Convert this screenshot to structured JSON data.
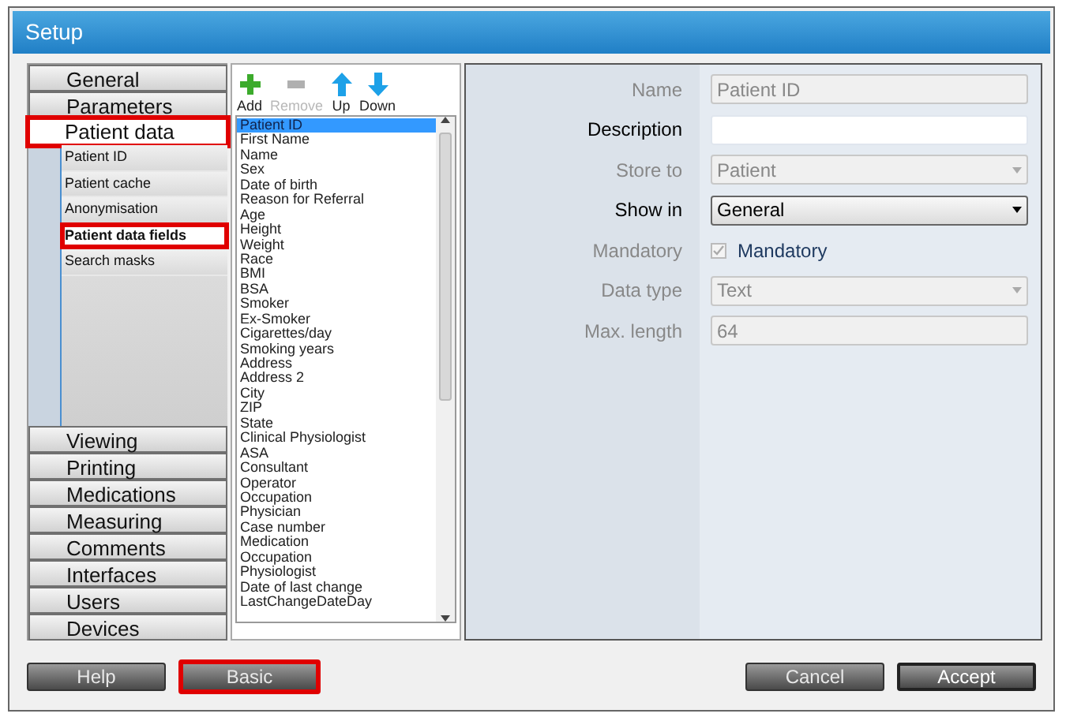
{
  "window": {
    "title": "Setup"
  },
  "nav_top": [
    {
      "label": "General",
      "selected": false,
      "highlighted": false
    },
    {
      "label": "Parameters",
      "selected": false,
      "highlighted": false
    },
    {
      "label": "Patient data",
      "selected": true,
      "highlighted": true
    }
  ],
  "sub_items": [
    {
      "label": "Patient ID",
      "selected": false,
      "highlighted": false
    },
    {
      "label": "Patient cache",
      "selected": false,
      "highlighted": false
    },
    {
      "label": "Anonymisation",
      "selected": false,
      "highlighted": false
    },
    {
      "label": "Patient data fields",
      "selected": true,
      "highlighted": true
    },
    {
      "label": "Search masks",
      "selected": false,
      "highlighted": false
    }
  ],
  "nav_bottom": [
    {
      "label": "Viewing",
      "selected": false,
      "highlighted": false
    },
    {
      "label": "Printing",
      "selected": false,
      "highlighted": false
    },
    {
      "label": "Medications",
      "selected": false,
      "highlighted": false
    },
    {
      "label": "Measuring",
      "selected": false,
      "highlighted": false
    },
    {
      "label": "Comments",
      "selected": false,
      "highlighted": false
    },
    {
      "label": "Interfaces",
      "selected": false,
      "highlighted": false
    },
    {
      "label": "Users",
      "selected": false,
      "highlighted": false
    },
    {
      "label": "Devices",
      "selected": false,
      "highlighted": false
    }
  ],
  "toolbar": [
    {
      "label": "Add",
      "kind": "add",
      "disabled": false
    },
    {
      "label": "Remove",
      "kind": "remove",
      "disabled": true
    },
    {
      "label": "Up",
      "kind": "up",
      "disabled": false
    },
    {
      "label": "Down",
      "kind": "down",
      "disabled": false
    }
  ],
  "fields_list": [
    {
      "label": "Patient ID",
      "selected": true
    },
    {
      "label": "First Name",
      "selected": false
    },
    {
      "label": "Name",
      "selected": false
    },
    {
      "label": "Sex",
      "selected": false
    },
    {
      "label": "Date of birth",
      "selected": false
    },
    {
      "label": "Reason for Referral",
      "selected": false
    },
    {
      "label": "Age",
      "selected": false
    },
    {
      "label": "Height",
      "selected": false
    },
    {
      "label": "Weight",
      "selected": false
    },
    {
      "label": "Race",
      "selected": false
    },
    {
      "label": "BMI",
      "selected": false
    },
    {
      "label": "BSA",
      "selected": false
    },
    {
      "label": "Smoker",
      "selected": false
    },
    {
      "label": "Ex-Smoker",
      "selected": false
    },
    {
      "label": "Cigarettes/day",
      "selected": false
    },
    {
      "label": "Smoking years",
      "selected": false
    },
    {
      "label": "Address",
      "selected": false
    },
    {
      "label": "Address 2",
      "selected": false
    },
    {
      "label": "City",
      "selected": false
    },
    {
      "label": "ZIP",
      "selected": false
    },
    {
      "label": "State",
      "selected": false
    },
    {
      "label": "Clinical Physiologist",
      "selected": false
    },
    {
      "label": "ASA",
      "selected": false
    },
    {
      "label": "Consultant",
      "selected": false
    },
    {
      "label": "Operator",
      "selected": false
    },
    {
      "label": "Occupation",
      "selected": false
    },
    {
      "label": "Physician",
      "selected": false
    },
    {
      "label": "Case number",
      "selected": false
    },
    {
      "label": "Medication",
      "selected": false
    },
    {
      "label": "Occupation",
      "selected": false
    },
    {
      "label": "Physiologist",
      "selected": false
    },
    {
      "label": "Date of last change",
      "selected": false
    },
    {
      "label": "LastChangeDateDay",
      "selected": false
    }
  ],
  "form": [
    {
      "label": "Name",
      "kind": "text",
      "disabled": true,
      "value": "Patient ID"
    },
    {
      "label": "Description",
      "kind": "text",
      "disabled": false
    },
    {
      "label": "Store to",
      "kind": "select",
      "disabled": true,
      "value": "Patient"
    },
    {
      "label": "Show in",
      "kind": "select",
      "disabled": false,
      "value": "General"
    },
    {
      "label": "Mandatory",
      "kind": "checkbox",
      "disabled": true,
      "checked": true,
      "text": "Mandatory"
    },
    {
      "label": "Data type",
      "kind": "select",
      "disabled": true,
      "value": "Text"
    },
    {
      "label": "Max. length",
      "kind": "text",
      "disabled": true,
      "value": "64"
    }
  ],
  "buttons_left": [
    {
      "label": "Help",
      "highlighted": false,
      "default": false
    },
    {
      "label": "Basic",
      "highlighted": true,
      "default": false
    }
  ],
  "buttons_right": [
    {
      "label": "Cancel",
      "highlighted": false,
      "default": false
    },
    {
      "label": "Accept",
      "highlighted": false,
      "default": true
    }
  ]
}
